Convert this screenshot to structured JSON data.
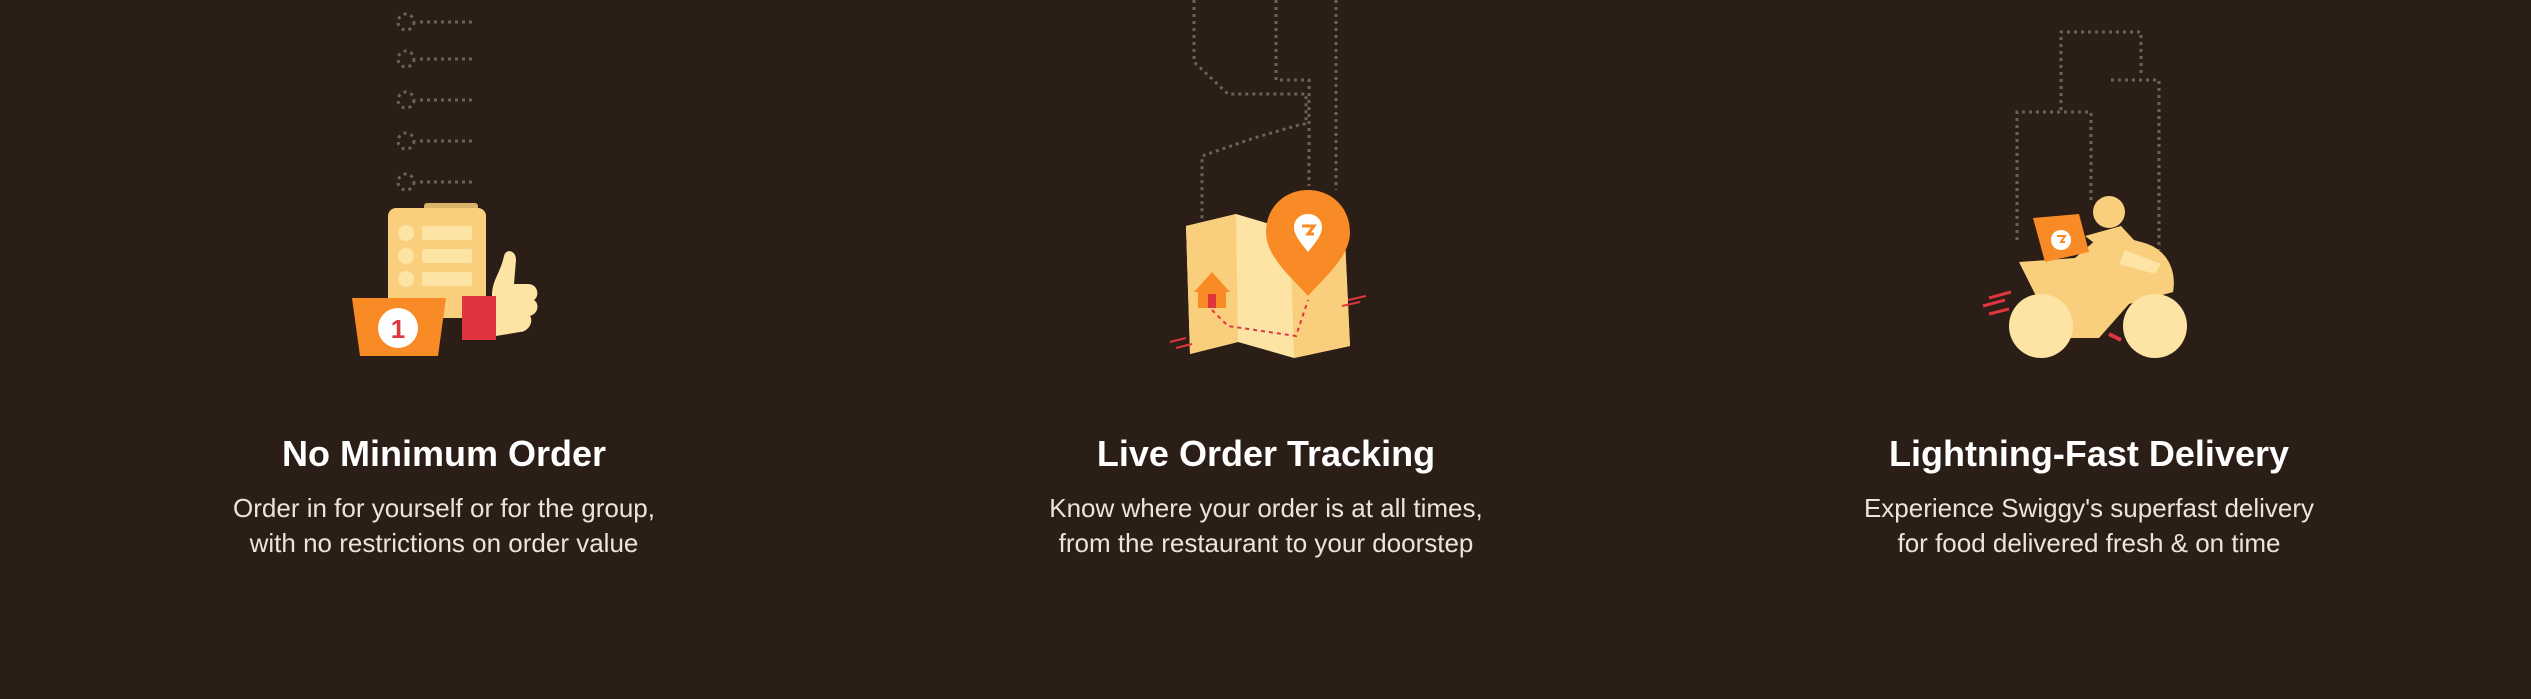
{
  "colors": {
    "background": "#2b1e16",
    "accent_orange": "#f98b26",
    "illustration_yellow": "#f9cf7d",
    "illustration_cream": "#fde3a4",
    "accent_red": "#e0353f",
    "dotted_line": "#6b615a"
  },
  "features": [
    {
      "icon": "clipboard-thumbs-up-icon",
      "badge_number": "1",
      "title": "No Minimum Order",
      "description_lines": [
        "Order in for yourself or for the group,",
        "with no restrictions on order value"
      ]
    },
    {
      "icon": "map-location-pin-icon",
      "title": "Live Order Tracking",
      "description_lines": [
        "Know where your order is at all times,",
        "from the restaurant to your doorstep"
      ]
    },
    {
      "icon": "delivery-scooter-icon",
      "title": "Lightning-Fast Delivery",
      "description_lines": [
        "Experience Swiggy's superfast delivery",
        "for food delivered fresh & on time"
      ]
    }
  ]
}
